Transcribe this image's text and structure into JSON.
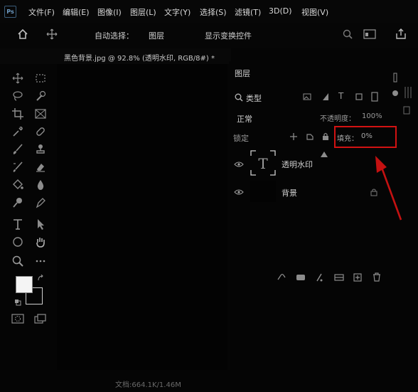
{
  "app": {
    "logo": "Ps"
  },
  "menu": [
    "文件(F)",
    "编辑(E)",
    "图像(I)",
    "图层(L)",
    "文字(Y)",
    "选择(S)",
    "滤镜(T)",
    "3D(D)",
    "视图(V)"
  ],
  "options": {
    "auto_select_label": "自动选择：",
    "auto_select_value": "图层",
    "show_transform": "显示变换控件"
  },
  "document": {
    "tab_title": "黑色背景.jpg @ 92.8% (透明水印, RGB/8#) *"
  },
  "layers_panel": {
    "title": "图层",
    "filter_kind": "类型",
    "blend_mode": "正常",
    "opacity_label": "不透明度：",
    "opacity_value": "100%",
    "lock_label": "锁定",
    "fill_label": "填充：",
    "fill_value": "0%",
    "layers": [
      {
        "name": "透明水印",
        "thumb": "T",
        "visible": true
      },
      {
        "name": "背景",
        "visible": true,
        "locked": true
      }
    ]
  },
  "status": {
    "doc_size": "文档:664.1K/1.46M"
  },
  "colors": {
    "annotation_red": "#d21212"
  }
}
